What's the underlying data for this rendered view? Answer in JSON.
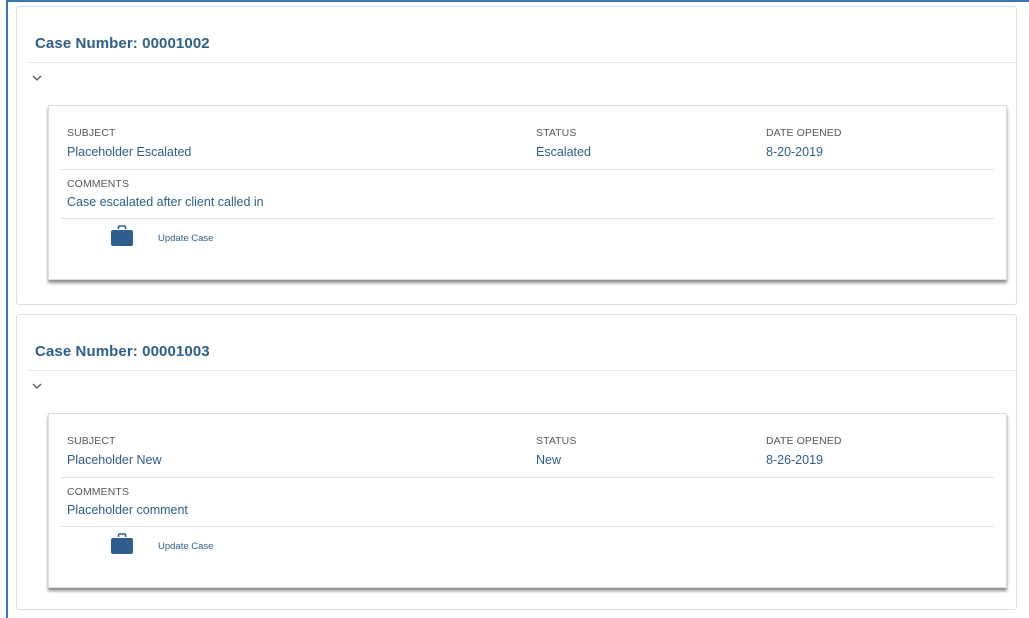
{
  "cases": [
    {
      "title": "Case Number: 00001002",
      "subject_label": "SUBJECT",
      "subject": "Placeholder Escalated",
      "status_label": "STATUS",
      "status": "Escalated",
      "date_label": "DATE OPENED",
      "date_opened": "8-20-2019",
      "comments_label": "COMMENTS",
      "comments": "Case escalated after client called in",
      "action_label": "Update Case"
    },
    {
      "title": "Case Number: 00001003",
      "subject_label": "SUBJECT",
      "subject": "Placeholder New",
      "status_label": "STATUS",
      "status": "New",
      "date_label": "DATE OPENED",
      "date_opened": "8-26-2019",
      "comments_label": "COMMENTS",
      "comments": "Placeholder comment",
      "action_label": "Update Case"
    }
  ],
  "icons": {
    "toggle": "chevron-down-icon",
    "action": "briefcase-icon"
  },
  "colors": {
    "accent": "#2b5f8e",
    "frame": "#3b73b9",
    "icon": "#2f5f8e"
  }
}
